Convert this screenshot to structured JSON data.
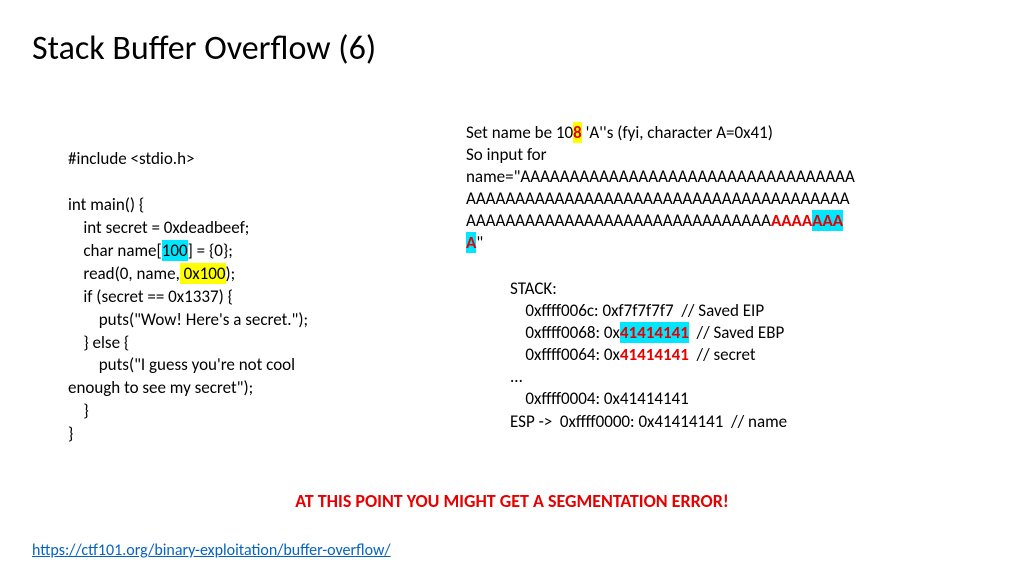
{
  "title": "Stack Buffer Overflow (6)",
  "code": {
    "l1": "#include <stdio.h>",
    "l2": "",
    "l3": "int main() {",
    "l4a": "    int secret = 0xdeadbeef;",
    "l5a": "    char name[",
    "l5b": "100",
    "l5c": "] = {0};",
    "l6a": "    read(0, name,",
    "l6b": " 0x100",
    "l6c": ");",
    "l7": "    if (secret == 0x1337) {",
    "l8": "        puts(\"Wow! Here's a secret.\");",
    "l9": "    } else {",
    "l10": "        puts(\"I guess you're not cool",
    "l11": "enough to see my secret\");",
    "l12": "    }",
    "l13": "}"
  },
  "explain": {
    "p1a": "Set name be 10",
    "p1b": "8",
    "p1c": " 'A''s (fyi, character A=0x41)",
    "p2": "So input for",
    "p3a": "name=\"AAAAAAAAAAAAAAAAAAAAAAAAAAAAAAAAAA",
    "p3b": "AAAAAAAAAAAAAAAAAAAAAAAAAAAAAAAAAAAAAAA",
    "p3c": "AAAAAAAAAAAAAAAAAAAAAAAAAAAAAAA",
    "p3d": "AAAA",
    "p3e": "AAA",
    "p3f": "A",
    "p3g": "\""
  },
  "stack": {
    "h": "STACK:",
    "r1": "    0xffff006c: 0xf7f7f7f7  // Saved EIP",
    "r2a": "    0xffff0068: 0x",
    "r2b": "41414141",
    "r2c": "  // Saved EBP",
    "r3a": "    0xffff0064: 0x",
    "r3b": "41414141",
    "r3c": "  // secret",
    "dots": "...",
    "r4": "    0xffff0004: 0x41414141",
    "r5": "ESP ->  0xffff0000: 0x41414141  // name"
  },
  "warning": "AT THIS POINT YOU MIGHT GET A SEGMENTATION ERROR!",
  "link": "https://ctf101.org/binary-exploitation/buffer-overflow/"
}
